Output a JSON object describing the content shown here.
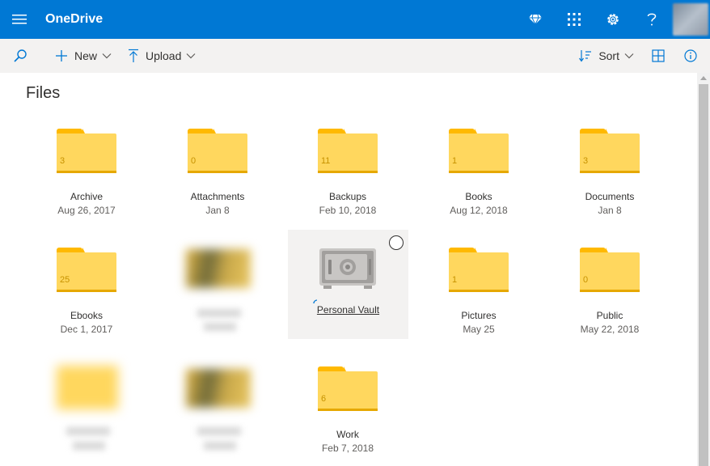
{
  "app": {
    "name": "OneDrive"
  },
  "topbar": {
    "icons": [
      "premium-diamond-icon",
      "app-grid-icon",
      "settings-gear-icon",
      "help-question-icon"
    ],
    "accent": "#0078d4"
  },
  "commandbar": {
    "new_label": "New",
    "upload_label": "Upload",
    "sort_label": "Sort"
  },
  "page": {
    "title": "Files"
  },
  "items": [
    {
      "name": "Archive",
      "date": "Aug 26, 2017",
      "count": "3"
    },
    {
      "name": "Attachments",
      "date": "Jan 8",
      "count": "0"
    },
    {
      "name": "Backups",
      "date": "Feb 10, 2018",
      "count": "11"
    },
    {
      "name": "Books",
      "date": "Aug 12, 2018",
      "count": "1"
    },
    {
      "name": "Documents",
      "date": "Jan 8",
      "count": "3"
    },
    {
      "name": "Ebooks",
      "date": "Dec 1, 2017",
      "count": "25"
    },
    {
      "name": "Personal Vault"
    },
    {
      "name": "Pictures",
      "date": "May 25",
      "count": "1"
    },
    {
      "name": "Public",
      "date": "May 22, 2018",
      "count": "0"
    },
    {
      "name": "Work",
      "date": "Feb 7, 2018",
      "count": "6"
    }
  ]
}
